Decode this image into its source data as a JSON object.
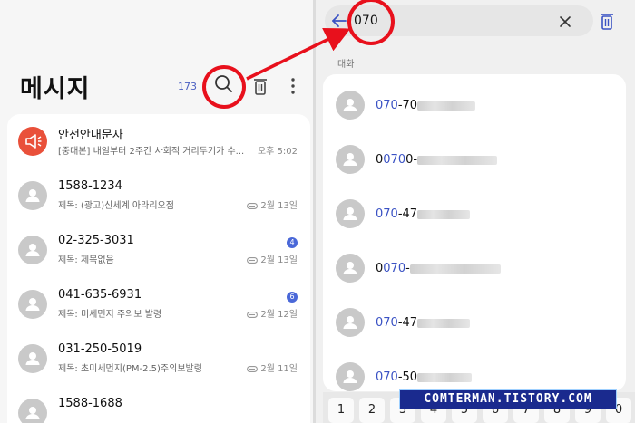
{
  "left": {
    "title": "메시지",
    "count": "173",
    "conversations": [
      {
        "name": "안전안내문자",
        "preview": "[중대본] 내일부터 2주간 사회적 거리두기가 수...",
        "time": "오후 5:02",
        "avatar": "alert-megaphone-icon"
      },
      {
        "name": "1588-1234",
        "preview": "제목: (광고)신세계 아라리오점",
        "time": "2월 13일",
        "attachment": true
      },
      {
        "name": "02-325-3031",
        "preview": "제목: 제목없음",
        "time": "2월 13일",
        "attachment": true,
        "badge": "4"
      },
      {
        "name": "041-635-6931",
        "preview": "제목: 미세먼지 주의보 발령",
        "time": "2월 12일",
        "attachment": true,
        "badge": "6"
      },
      {
        "name": "031-250-5019",
        "preview": "제목: 초미세먼지(PM-2.5)주의보발령",
        "time": "2월 11일",
        "attachment": true
      },
      {
        "name": "1588-1688",
        "preview": "",
        "time": ""
      }
    ]
  },
  "right": {
    "search_value": "070",
    "section_label": "대화",
    "results": [
      {
        "prefix": "",
        "highlight": "070",
        "suffix": "-70"
      },
      {
        "prefix": "0",
        "highlight": "070",
        "suffix": "0-"
      },
      {
        "prefix": "",
        "highlight": "070",
        "suffix": "-47"
      },
      {
        "prefix": "0",
        "highlight": "070",
        "suffix": "-"
      },
      {
        "prefix": "",
        "highlight": "070",
        "suffix": "-47"
      },
      {
        "prefix": "",
        "highlight": "070",
        "suffix": "-50"
      }
    ],
    "keys": [
      "1",
      "2",
      "3",
      "4",
      "5",
      "6",
      "7",
      "8",
      "9",
      "0"
    ]
  },
  "watermark": "COMTERMAN.TISTORY.COM",
  "colors": {
    "accent": "#3a52c4",
    "annotation": "#e8101c",
    "alert": "#e9503a"
  }
}
